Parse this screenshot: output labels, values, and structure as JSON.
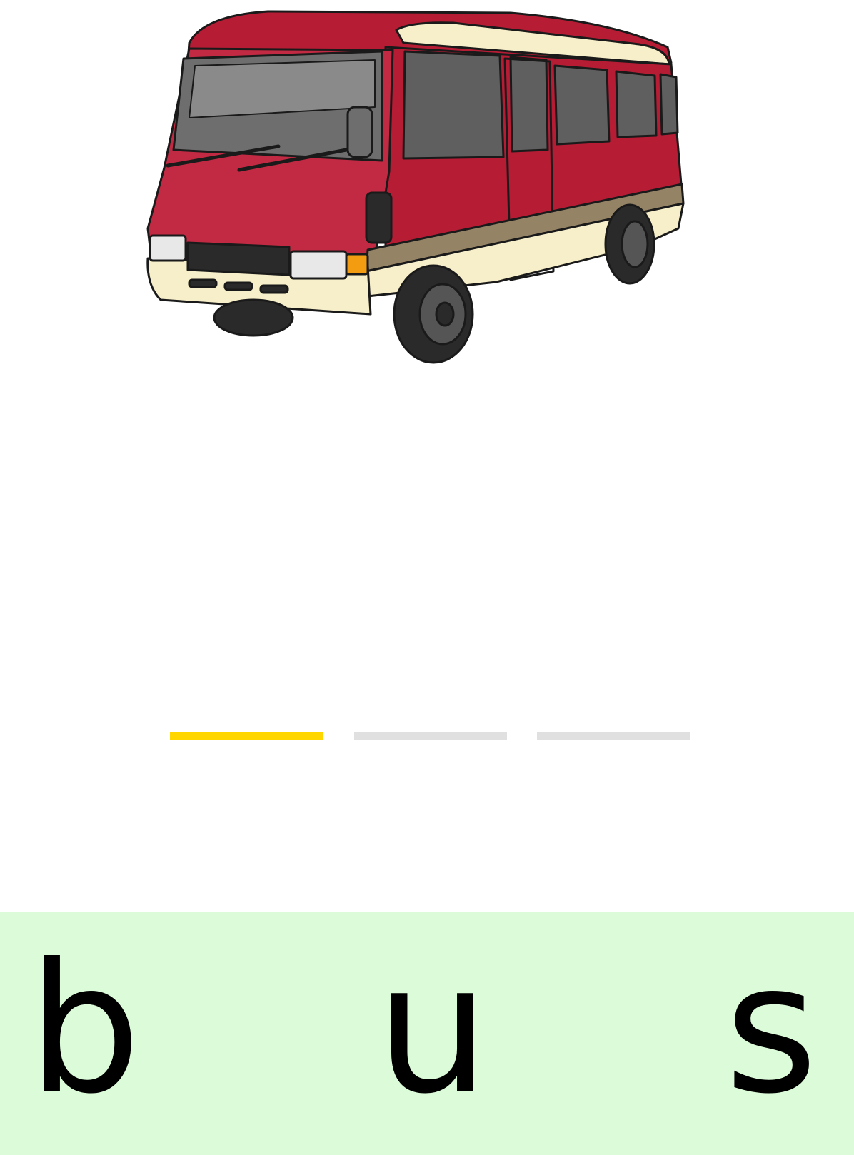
{
  "picture": {
    "subject_icon": "bus-icon",
    "colors": {
      "body": "#b71c35",
      "trim": "#f7efc9",
      "stripe": "#958366",
      "glass": "#6e6e6e",
      "tyre": "#2a2a2a",
      "indicator": "#f39c12"
    }
  },
  "slots": {
    "count": 3,
    "active_index": 0,
    "active_color": "#ffd600",
    "empty_color": "#e0e0e0"
  },
  "tray": {
    "background": "#dcfbd9",
    "letters": [
      "b",
      "u",
      "s"
    ]
  }
}
